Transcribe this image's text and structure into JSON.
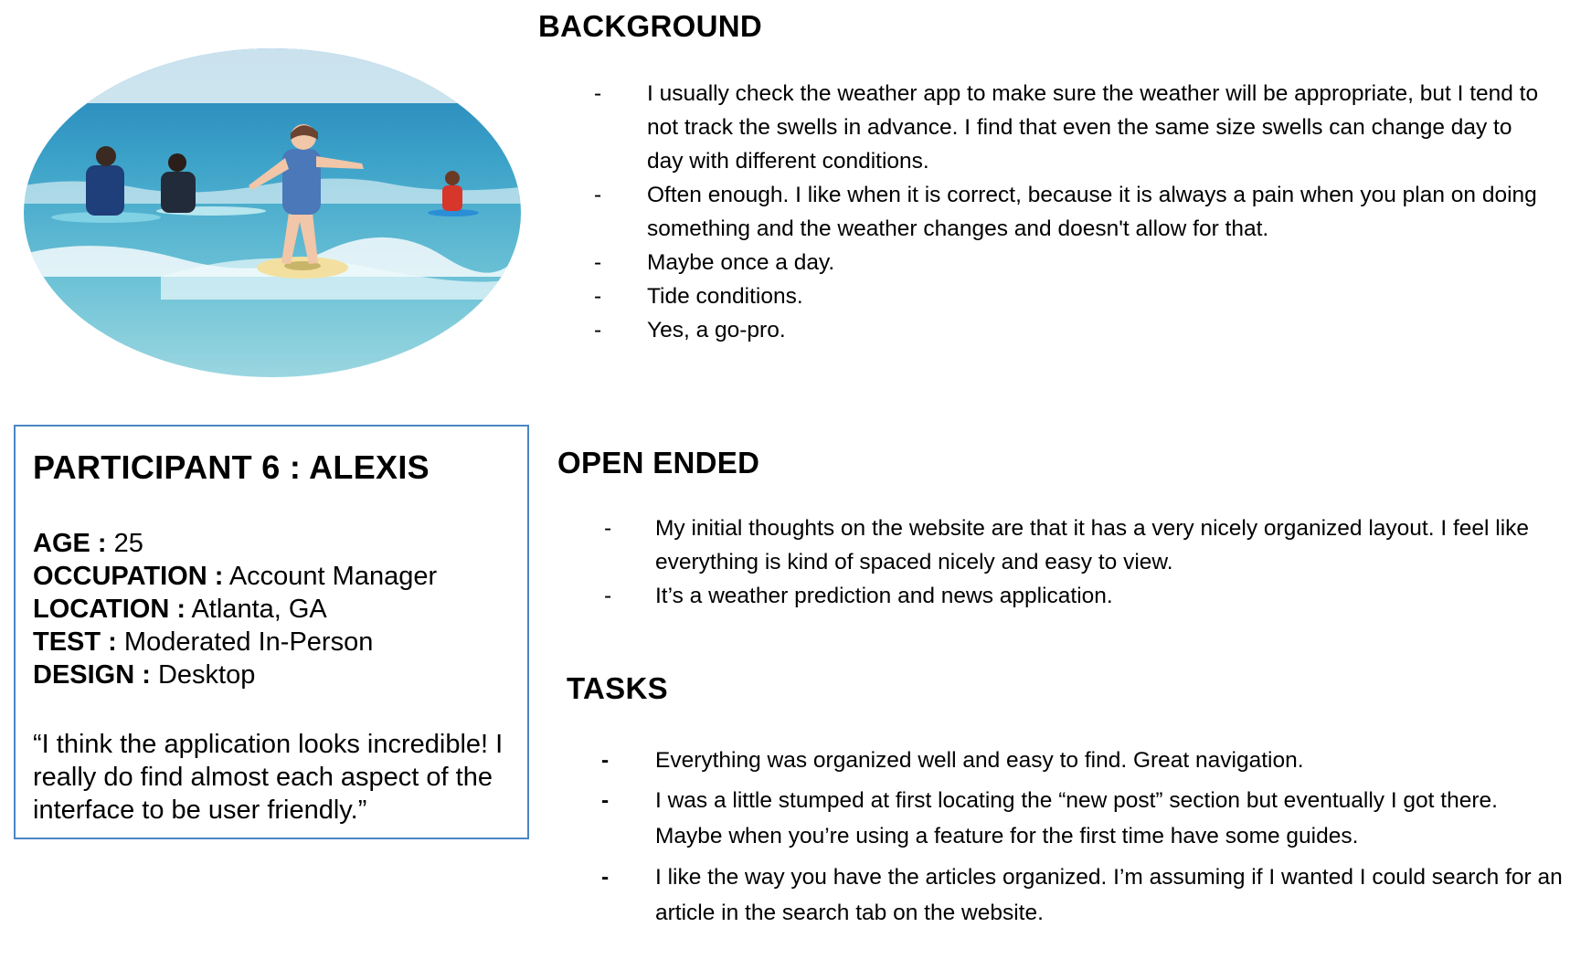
{
  "background": {
    "title": "BACKGROUND",
    "items": [
      "I usually check the weather app to make sure the weather will be appropriate, but I tend to not track the swells in advance. I find that even the same size swells can change day to day with different conditions.",
      "Often enough. I like when it is correct, because it is always a pain when you plan on doing something and the weather changes and doesn't allow for that.",
      "Maybe once a day.",
      "Tide conditions.",
      "Yes, a go-pro."
    ]
  },
  "participant": {
    "title": "PARTICIPANT  6 : ALEXIS",
    "age_label": "AGE :",
    "age": "25",
    "occupation_label": "OCCUPATION  :",
    "occupation": "Account Manager",
    "location_label": "LOCATION :",
    "location": "Atlanta, GA",
    "test_label": "TEST :",
    "test": "Moderated In-Person",
    "design_label": "DESIGN :",
    "design": "Desktop",
    "quote": "“I think the application looks incredible! I really do find almost each aspect of the interface to be user friendly.”"
  },
  "open_ended": {
    "title": "OPEN ENDED",
    "items": [
      "My initial thoughts on the website are that it has a very nicely organized layout. I feel like everything is kind of spaced nicely and easy to view.",
      "It’s a weather prediction and news application."
    ]
  },
  "tasks": {
    "title": "TASKS",
    "items": [
      "Everything was organized well and easy to find. Great navigation.",
      "I was a little stumped at first locating the “new post” section but eventually I got there. Maybe when you’re using a feature for the first time have some guides.",
      "I like the way you have the articles organized. I’m assuming if I wanted I could search for an article in the search tab on the website."
    ]
  },
  "dash": "-"
}
